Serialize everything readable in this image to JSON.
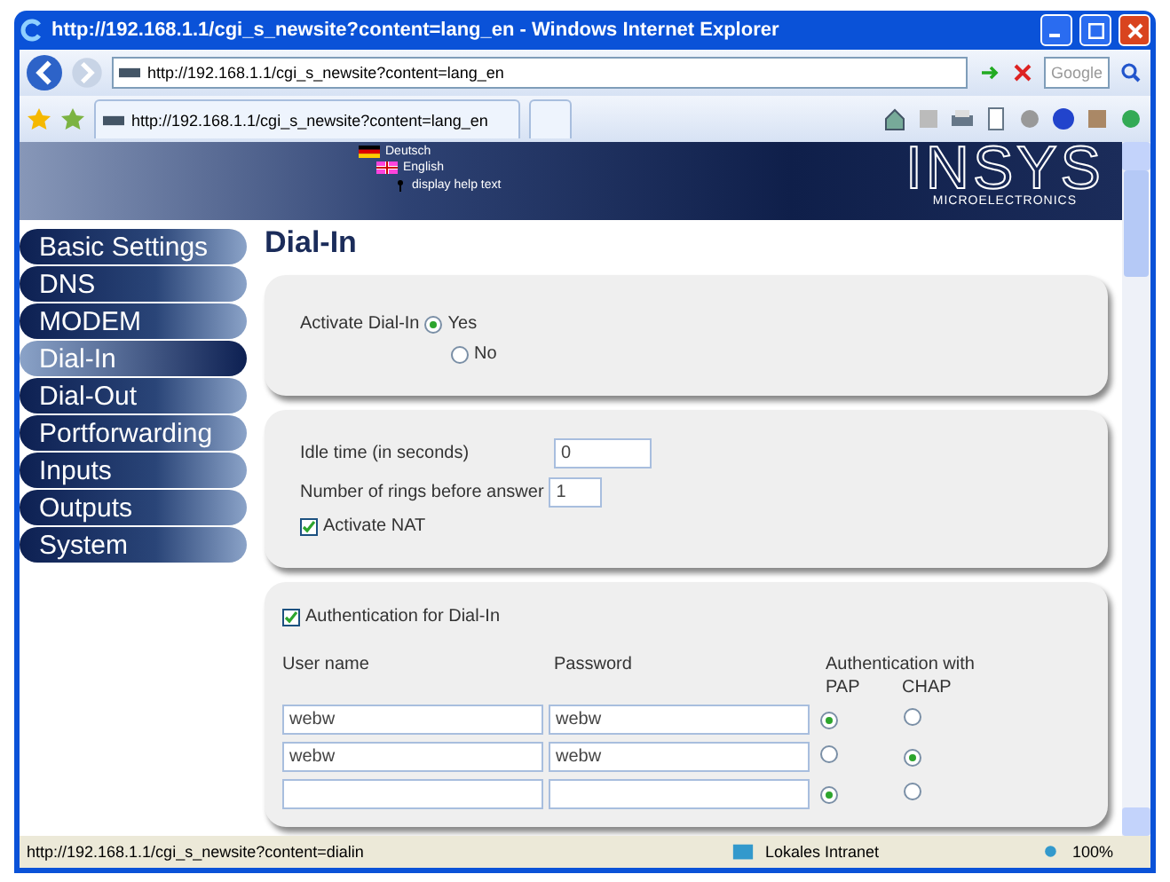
{
  "window": {
    "title": "http://192.168.1.1/cgi_s_newsite?content=lang_en - Windows Internet Explorer"
  },
  "address_bar": {
    "url": "http://192.168.1.1/cgi_s_newsite?content=lang_en"
  },
  "search": {
    "placeholder": "Google"
  },
  "tab": {
    "title": "http://192.168.1.1/cgi_s_newsite?content=lang_en"
  },
  "header": {
    "languages": [
      {
        "label": "Deutsch",
        "kind": "de"
      },
      {
        "label": "English",
        "kind": "en"
      }
    ],
    "help_link": "display help text",
    "logo": "INSYS",
    "logo_sub": "MICROELECTRONICS"
  },
  "sidebar": {
    "items": [
      {
        "label": "Basic Settings",
        "selected": false
      },
      {
        "label": "DNS",
        "selected": false
      },
      {
        "label": "MODEM",
        "selected": false
      },
      {
        "label": "Dial-In",
        "selected": true
      },
      {
        "label": "Dial-Out",
        "selected": false
      },
      {
        "label": "Portforwarding",
        "selected": false
      },
      {
        "label": "Inputs",
        "selected": false
      },
      {
        "label": "Outputs",
        "selected": false
      },
      {
        "label": "System",
        "selected": false
      }
    ]
  },
  "page_title": "Dial-In",
  "activate": {
    "label": "Activate Dial-In",
    "options": [
      {
        "label": "Yes",
        "selected": true
      },
      {
        "label": "No",
        "selected": false
      }
    ]
  },
  "settings": {
    "fields": [
      {
        "label": "Idle time (in seconds)",
        "value": "0"
      },
      {
        "label": "Number of rings before answer",
        "value": "1"
      }
    ],
    "nat": {
      "label": "Activate NAT",
      "checked": true
    }
  },
  "auth": {
    "enable": {
      "label": "Authentication for Dial-In",
      "checked": true
    },
    "columns": [
      "User name",
      "Password",
      "Authentication with"
    ],
    "methods": [
      "PAP",
      "CHAP"
    ],
    "rows": [
      {
        "user": "webw",
        "password": "webw",
        "pap": true,
        "chap": false
      },
      {
        "user": "webw",
        "password": "webw",
        "pap": false,
        "chap": true
      },
      {
        "user": "",
        "password": "",
        "pap": true,
        "chap": false
      }
    ]
  },
  "status_bar": {
    "url": "http://192.168.1.1/cgi_s_newsite?content=dialin",
    "zone": "Lokales Intranet",
    "zoom": "100%"
  }
}
